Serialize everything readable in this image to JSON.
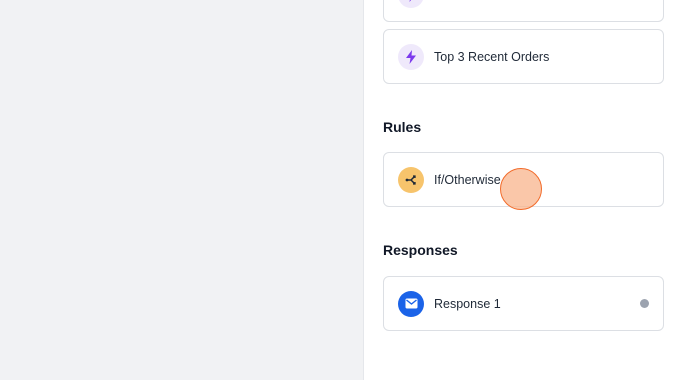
{
  "panel": {
    "cards_top": [
      {
        "label": "",
        "icon": "lightning-icon",
        "icon_color": "#7c3aed"
      },
      {
        "label": "Top 3 Recent Orders",
        "icon": "lightning-icon",
        "icon_color": "#7c3aed"
      }
    ],
    "rules": {
      "title": "Rules",
      "items": [
        {
          "label": "If/Otherwise",
          "icon": "branch-icon",
          "icon_color": "#1f2937"
        }
      ]
    },
    "responses": {
      "title": "Responses",
      "items": [
        {
          "label": "Response 1",
          "icon": "mail-icon",
          "icon_color": "#ffffff",
          "status_color": "#9ca3af"
        }
      ]
    }
  }
}
